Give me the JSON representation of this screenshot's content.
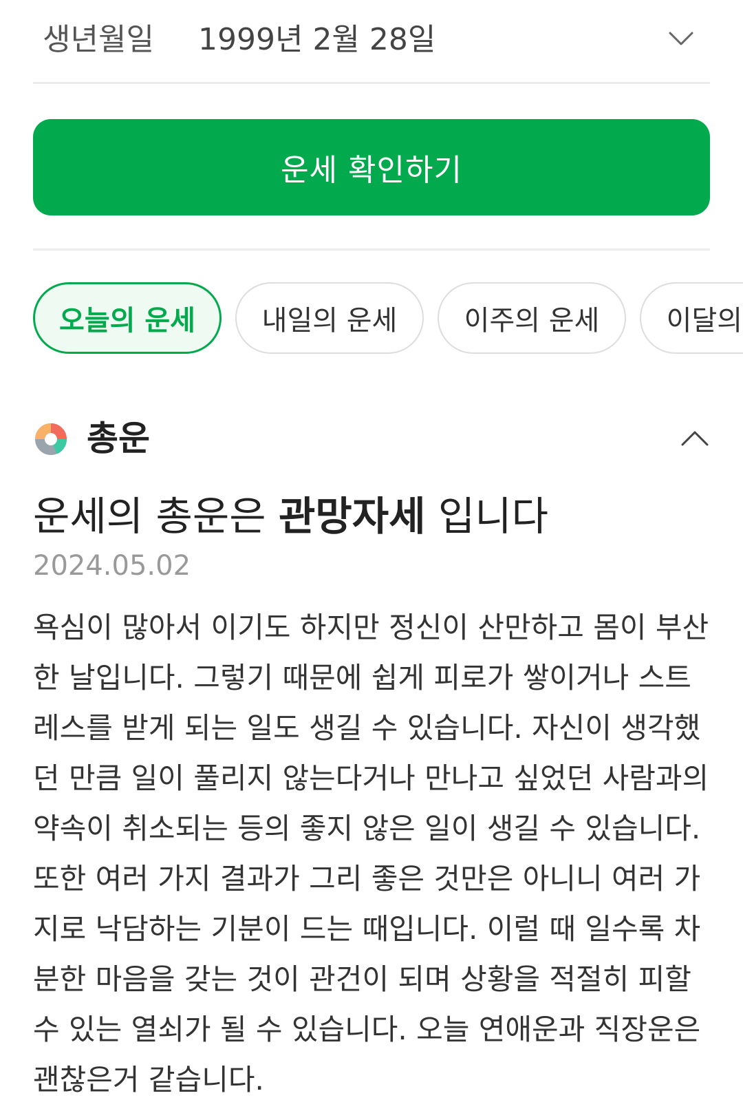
{
  "birth": {
    "label": "생년월일",
    "value": "1999년 2월 28일",
    "dropdown_icon": "chevron-down-icon"
  },
  "confirm_button": {
    "label": "운세 확인하기",
    "color": "#03a94d"
  },
  "tabs": [
    {
      "label": "오늘의 운세",
      "selected": true
    },
    {
      "label": "내일의 운세",
      "selected": false
    },
    {
      "label": "이주의 운세",
      "selected": false
    },
    {
      "label": "이달의 운세",
      "selected": false
    }
  ],
  "section": {
    "icon": "donut-chart-icon",
    "title": "총운",
    "collapse_icon": "chevron-up-icon"
  },
  "headline": {
    "prefix": "운세의 총운은 ",
    "highlight": "관망자세",
    "suffix": " 입니다"
  },
  "date": "2024.05.02",
  "body": "욕심이 많아서 이기도 하지만 정신이 산만하고 몸이 부산한 날입니다. 그렇기 때문에 쉽게 피로가 쌓이거나 스트레스를 받게 되는 일도 생길 수 있습니다. 자신이 생각했던 만큼 일이 풀리지 않는다거나 만나고 싶었던 사람과의 약속이 취소되는 등의 좋지 않은 일이 생길 수 있습니다. 또한 여러 가지 결과가 그리 좋은 것만은 아니니 여러 가지로 낙담하는 기분이 드는 때입니다. 이럴 때 일수록 차분한 마음을 갖는 것이 관건이 되며 상황을 적절히 피할 수 있는 열쇠가 될 수 있습니다. 오늘 연애운과 직장운은 괜찮은거 같습니다."
}
